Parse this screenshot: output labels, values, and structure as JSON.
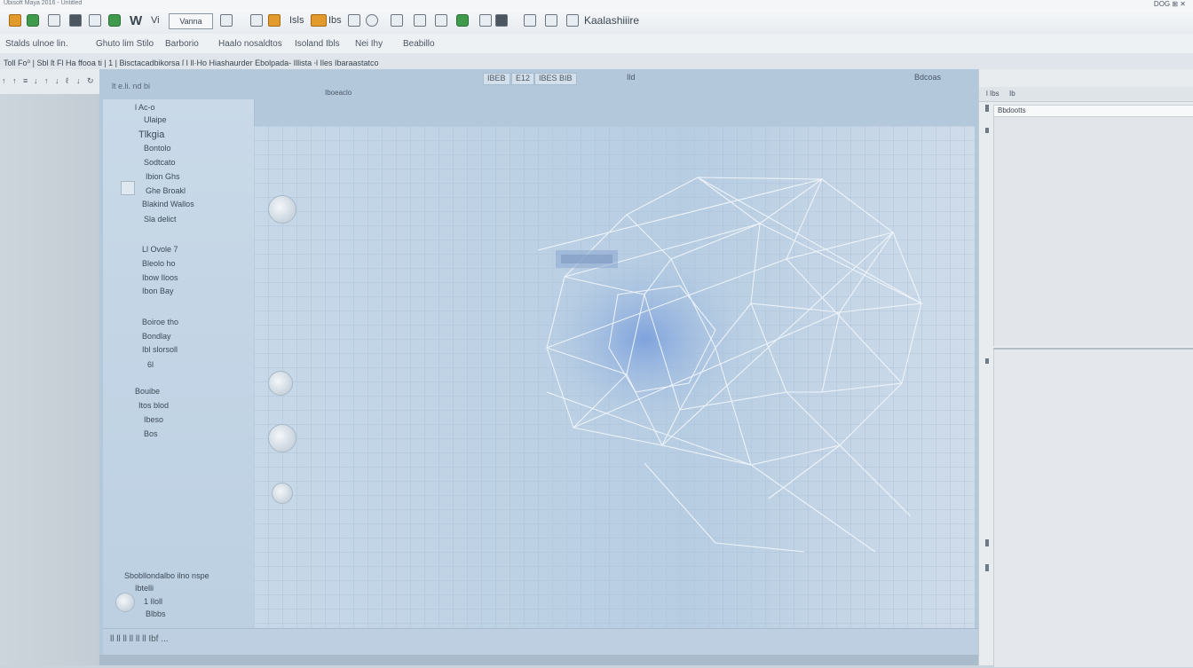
{
  "titlebar": {
    "title": "Ubisoft Maya 2016 - Untitled",
    "right_text": "DOG ⊞ ✕"
  },
  "toolbar": {
    "icons": [
      "layout-icon",
      "record-icon",
      "chart-icon",
      "grid-icon",
      "select-icon"
    ],
    "items": [
      "W",
      "Vi",
      "Vanna"
    ],
    "object_label": "Isls",
    "spacer_label": "Ibs",
    "workspace_label": "Kaalashiiire"
  },
  "menubar": {
    "items": [
      "Stalds ulnoe lin.",
      "Ghuto lim Stilo",
      "Barborio",
      "Haalo nosaldtos",
      "Isoland Ibls",
      "Nei Ihy",
      "Beabillo"
    ]
  },
  "propbar": {
    "text": "Toll Fo⁰ | Sbl ſt Fl Ha ffooa ti | 1 | Bisctacadbikorsa ſ I ll·Ho Hiashaurder Ebolpada- Illista ⸱l Iles Ibaraastatco"
  },
  "subtool": {
    "icons": [
      "↑",
      "↑",
      "≡",
      "↓",
      "↑",
      "↓",
      "ℓ",
      "↓",
      "↻"
    ]
  },
  "outliner": {
    "header": "lt e.li. nd bi",
    "rows": [
      "l Ac-o",
      "Ulaipe",
      "Tlkgia",
      "Bontolo",
      "Sodtcato",
      "Ibion Ghs",
      "Ghe Broakl",
      "Blakind Wallos",
      "Sla delict",
      "Ll Ovole 7",
      "Bleolo ho",
      "Ibow Iloos",
      "Ibon Bay",
      "Boiroe tho",
      "Bondlay",
      "Ibl slorsoll",
      "6l",
      "Bouibe",
      "Itos blod",
      "Ibeso",
      "Bos"
    ],
    "footer": [
      "Sbobllondalbo ilno nspe",
      "Ibtelli",
      "1 Iloll",
      "Blbbs"
    ]
  },
  "viewport": {
    "tabs": [
      "IBEB",
      "E12",
      "IBES BIB"
    ],
    "label_left": "Iboeaclo",
    "label_right": "Bdcoas",
    "label_center": "Ild"
  },
  "bottombar": {
    "text": "ll ll ll ll ll ll Ibf ..."
  },
  "rightpanel": {
    "header": [
      "l Ibs",
      "Ib"
    ],
    "selected": "Bbdootts"
  }
}
